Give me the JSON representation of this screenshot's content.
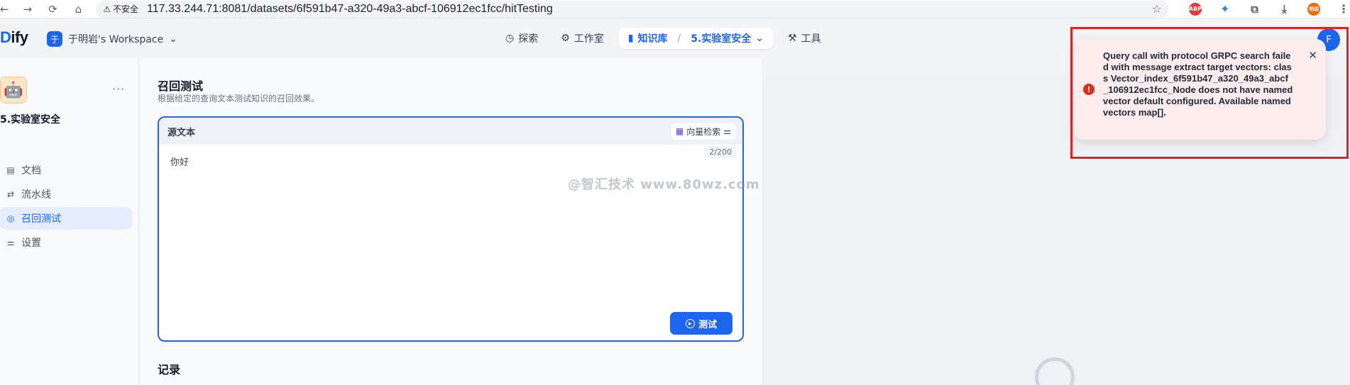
{
  "browser": {
    "security_label": "不安全",
    "url": "117.33.244.71:8081/datasets/6f591b47-a320-49a3-abcf-106912ec1fcc/hitTesting",
    "ext_abp": "ABP",
    "ext_avatar": "明岩"
  },
  "header": {
    "logo_a": "D",
    "logo_b": "ify",
    "workspace_badge": "于",
    "workspace_name": "于明岩's Workspace",
    "nav": {
      "explore": "探索",
      "studio": "工作室",
      "knowledge": "知识库",
      "dataset": "5.实验室安全",
      "tools": "工具"
    },
    "user_initial": "F"
  },
  "sidebar": {
    "dataset_name": "5.实验室安全",
    "items": [
      {
        "label": "文档"
      },
      {
        "label": "流水线"
      },
      {
        "label": "召回测试"
      },
      {
        "label": "设置"
      }
    ]
  },
  "main": {
    "title": "召回测试",
    "subtitle": "根据给定的查询文本测试知识的召回效果。",
    "editor": {
      "label": "源文本",
      "method": "向量检索",
      "counter": "2/200",
      "query": "你好",
      "test_button": "测试"
    },
    "records_title": "记录",
    "watermark": "@智汇技术 www.80wz.com"
  },
  "toast": {
    "message": "Query call with protocol GRPC search failed with message extract target vectors: class Vector_index_6f591b47_a320_49a3_abcf_106912ec1fcc_Node does not have named vector default configured. Available named vectors map[].",
    "status_color": "#d92d20"
  }
}
